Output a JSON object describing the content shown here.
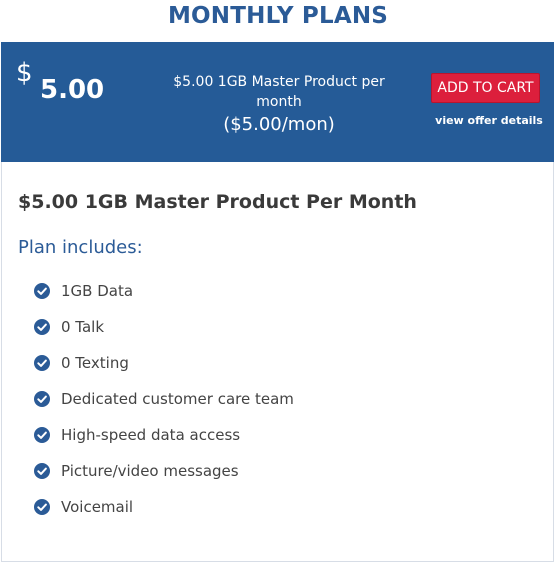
{
  "page": {
    "title": "MONTHLY PLANS"
  },
  "plan": {
    "currency_symbol": "$",
    "price": "5.00",
    "banner_name": "$5.00 1GB Master Product per month",
    "banner_price_per": "($5.00/mon)",
    "add_to_cart_label": "ADD TO CART",
    "details_link": "view offer details",
    "product_heading": "$5.00 1GB Master Product Per Month",
    "includes_heading": "Plan includes:",
    "features": [
      "1GB Data",
      "0 Talk",
      "0 Texting",
      "Dedicated customer care team",
      "High-speed data access",
      "Picture/video messages",
      "Voicemail"
    ]
  },
  "colors": {
    "brand_blue": "#255b97",
    "title_blue": "#2b5b97",
    "cart_red": "#dc1f3c",
    "check_blue": "#2b5b97"
  },
  "icons": {
    "feature_bullet": "check-circle-icon"
  }
}
